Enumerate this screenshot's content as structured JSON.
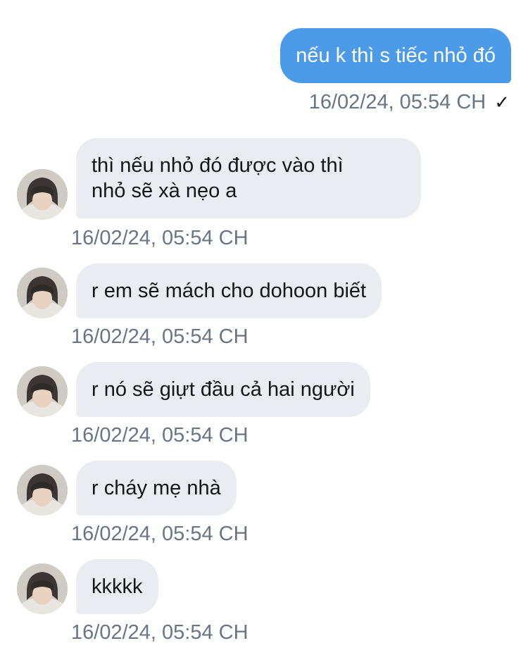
{
  "conversation": {
    "outgoing": [
      {
        "text": "nếu k thì s tiếc nhỏ đó",
        "timestamp": "16/02/24, 05:54 CH",
        "status_icon": "checkmark-icon"
      }
    ],
    "incoming": [
      {
        "lines": [
          "thì nếu nhỏ đó được vào thì",
          "nhỏ sẽ xà nẹo a"
        ],
        "timestamp": "16/02/24, 05:54 CH"
      },
      {
        "lines": [
          "r em sẽ mách cho dohoon biết"
        ],
        "timestamp": "16/02/24, 05:54 CH"
      },
      {
        "lines": [
          "r nó sẽ giựt đầu cả hai người"
        ],
        "timestamp": "16/02/24, 05:54 CH"
      },
      {
        "lines": [
          "r cháy mẹ nhà"
        ],
        "timestamp": "16/02/24, 05:54 CH"
      },
      {
        "lines": [
          "kkkkk"
        ],
        "timestamp": "16/02/24, 05:54 CH"
      }
    ]
  },
  "colors": {
    "outgoing_bubble": "#4c9be9",
    "incoming_bubble": "#e9edf2",
    "timestamp_text": "#687684"
  }
}
